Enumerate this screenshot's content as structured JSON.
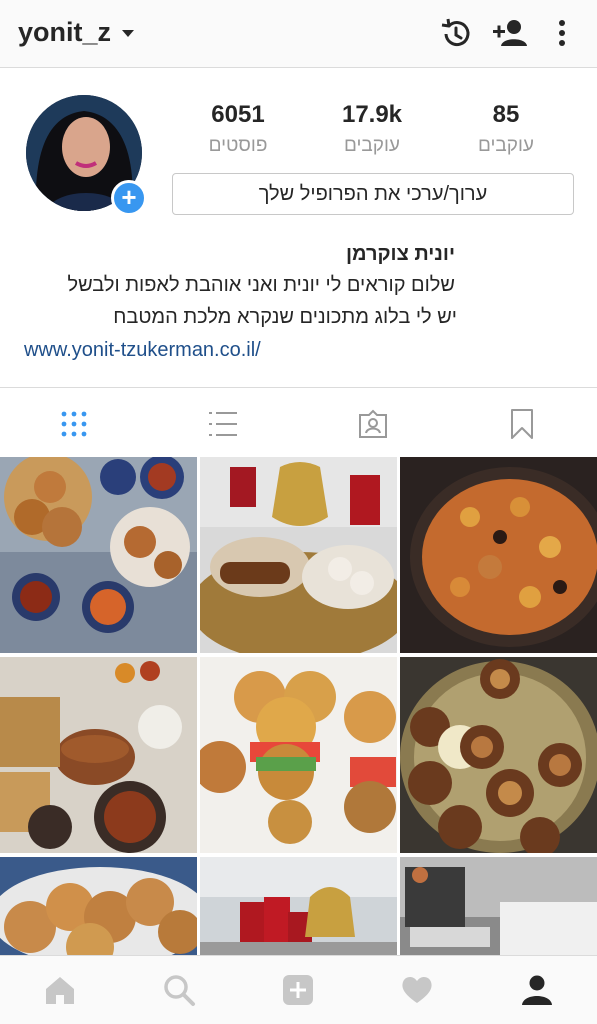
{
  "topbar": {
    "username": "yonit_z",
    "icons": [
      "caret-down-icon",
      "history-icon",
      "add-person-icon",
      "more-vert-icon"
    ]
  },
  "profile": {
    "stats": [
      {
        "value": "6051",
        "label": "פוסטים"
      },
      {
        "value": "17.9k",
        "label": "עוקבים"
      },
      {
        "value": "85",
        "label": "עוקבים"
      }
    ],
    "edit_button": "ערוך/ערכי את הפרופיל שלך",
    "name": "יונית צוקרמן",
    "bio_line1": "שלום קוראים לי יונית ואני אוהבת לאפות ולבשל",
    "bio_line2": "יש לי בלוג מתכונים שנקרא מלכת המטבח",
    "link": "www.yonit-tzukerman.co.il/"
  },
  "tabs": [
    "grid-icon",
    "list-icon",
    "tagged-icon",
    "bookmark-icon"
  ],
  "bottom_nav": [
    "home-icon",
    "search-icon",
    "add-icon",
    "heart-icon",
    "profile-icon"
  ],
  "colors": {
    "accent": "#3897f0",
    "link": "#1f4f8a",
    "muted": "#999999"
  }
}
